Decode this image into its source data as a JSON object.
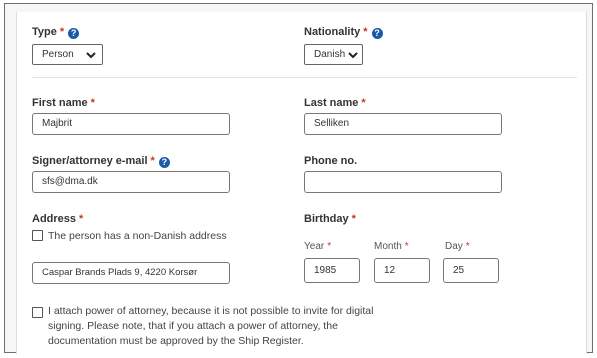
{
  "type": {
    "label": "Type",
    "required_mark": "*",
    "help_icon": "question-circle-icon",
    "value": "Person"
  },
  "nationality": {
    "label": "Nationality",
    "required_mark": "*",
    "help_icon": "question-circle-icon",
    "value": "Danish"
  },
  "first_name": {
    "label": "First name",
    "required_mark": "*",
    "value": "Majbrit"
  },
  "last_name": {
    "label": "Last name",
    "required_mark": "*",
    "value": "Selliken"
  },
  "email": {
    "label": "Signer/attorney e-mail",
    "required_mark": "*",
    "help_icon": "question-circle-icon",
    "value": "sfs@dma.dk"
  },
  "phone": {
    "label": "Phone no.",
    "value": ""
  },
  "address": {
    "label": "Address",
    "required_mark": "*",
    "non_danish_checkbox_label": "The person has a non-Danish address",
    "non_danish_checked": false,
    "value": "Caspar Brands Plads 9, 4220 Korsør"
  },
  "birthday": {
    "label": "Birthday",
    "required_mark": "*",
    "year_label": "Year",
    "month_label": "Month",
    "day_label": "Day",
    "year": "1985",
    "month": "12",
    "day": "25"
  },
  "power_of_attorney": {
    "checked": false,
    "line1": "I attach power of attorney, because it is not possible to invite for digital",
    "line2": "signing. Please note, that if you attach a power of attorney, the",
    "line3": "documentation must be approved by the Ship Register."
  },
  "colors": {
    "required": "#c0392b",
    "help_icon": "#1a5aa8",
    "border": "#777777"
  }
}
